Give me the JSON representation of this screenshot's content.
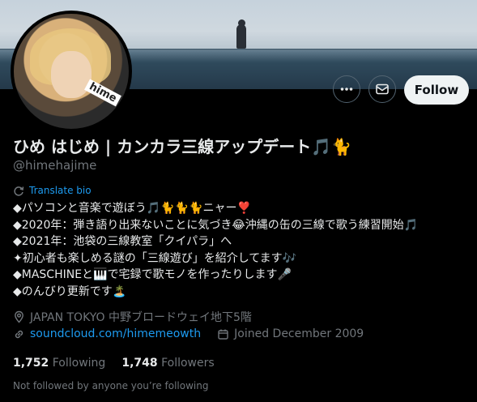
{
  "profile": {
    "display_name": "ひめ はじめ | カンカラ三線アップデート🎵🐈",
    "handle": "@himehajime",
    "avatar_tag": "hime",
    "translate_label": "Translate bio",
    "bio_lines": [
      "◆パソコンと音楽で遊ぼう🎵🐈🐈🐈ニャー❣️",
      "◆2020年：弾き語り出来ないことに気づき😂沖縄の缶の三線で歌う練習開始🎵",
      "◆2021年：池袋の三線教室「クイパラ」へ",
      "✦初心者も楽しめる謎の「三線遊び」を紹介してます🎶",
      "◆MASCHINEと🎹で宅録で歌モノを作ったりします🎤",
      "◆のんびり更新です🏝️"
    ],
    "location": "JAPAN TOKYO 中野ブロードウェイ地下5階",
    "website": "soundcloud.com/himemeowth",
    "joined": "Joined December 2009",
    "following_count": "1,752",
    "following_label": "Following",
    "followers_count": "1,748",
    "followers_label": "Followers",
    "not_followed": "Not followed by anyone you’re following"
  },
  "actions": {
    "more_icon": "more-horizontal-icon",
    "message_icon": "envelope-icon",
    "follow_label": "Follow"
  },
  "colors": {
    "background": "#000000",
    "text_primary": "#e7e9ea",
    "text_secondary": "#71767b",
    "link": "#1d9bf0",
    "follow_bg": "#eff3f4"
  }
}
